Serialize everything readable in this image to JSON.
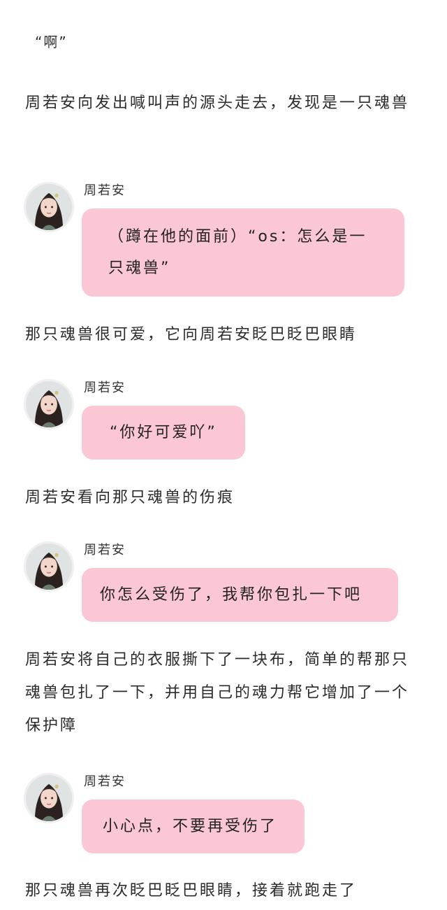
{
  "story": {
    "opening_quote": "“啊”",
    "p1": "周若安向发出喊叫声的源头走去，发现是一只魂兽",
    "p2": "那只魂兽很可爱，它向周若安眨巴眨巴眼睛",
    "p3": "周若安看向那只魂兽的伤痕",
    "p4": "周若安将自己的衣服撕下了一块布，简单的帮那只魂兽包扎了一下，并用自己的魂力帮它增加了一个保护障",
    "p5": "那只魂兽再次眨巴眨巴眼睛，接着就跑走了"
  },
  "messages": [
    {
      "speaker": "周若安",
      "text": "（蹲在他的面前）“os：怎么是一只魂兽”"
    },
    {
      "speaker": "周若安",
      "text": "“你好可爱吖”"
    },
    {
      "speaker": "周若安",
      "text": "你怎么受伤了，我帮你包扎一下吧"
    },
    {
      "speaker": "周若安",
      "text": "小心点，不要再受伤了"
    }
  ],
  "colors": {
    "bubble": "#fbc7d4",
    "background": "#ffffff"
  },
  "icons": {
    "avatar": "character-portrait"
  }
}
